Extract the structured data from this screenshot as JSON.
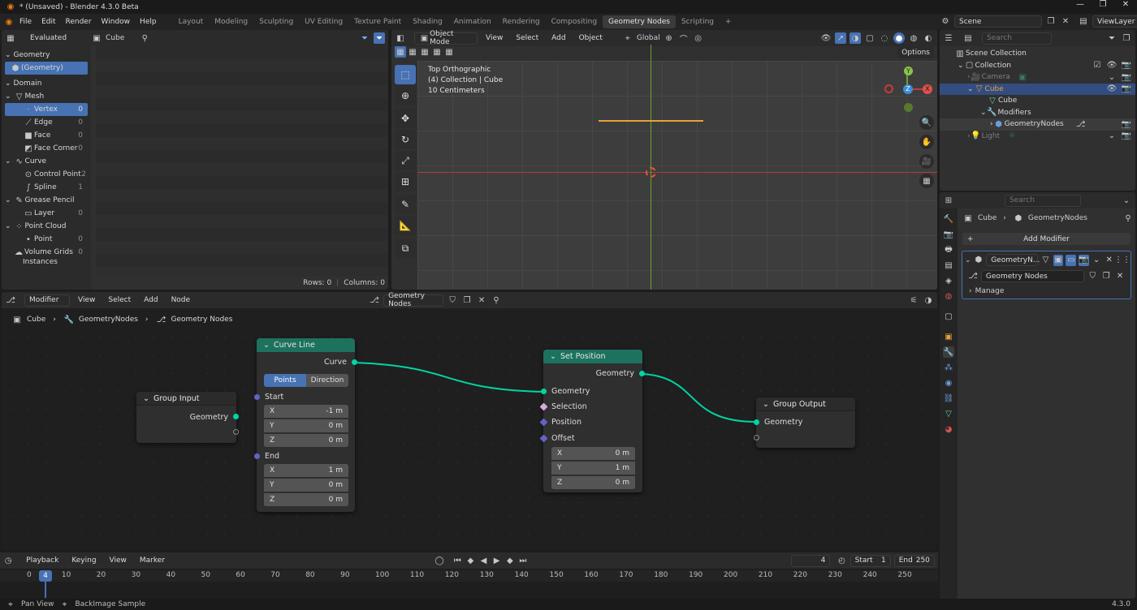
{
  "window": {
    "title": "* (Unsaved) - Blender 4.3.0 Beta"
  },
  "menu": [
    "File",
    "Edit",
    "Render",
    "Window",
    "Help"
  ],
  "workspaces": [
    "Layout",
    "Modeling",
    "Sculpting",
    "UV Editing",
    "Texture Paint",
    "Shading",
    "Animation",
    "Rendering",
    "Compositing",
    "Geometry Nodes",
    "Scripting"
  ],
  "active_workspace": "Geometry Nodes",
  "scene": {
    "name": "Scene",
    "view_layer": "ViewLayer"
  },
  "spreadsheet": {
    "mode": "Evaluated",
    "object": "Cube",
    "geometry_label": "Geometry",
    "geometry_item": "(Geometry)",
    "domain_label": "Domain",
    "mesh": {
      "label": "Mesh",
      "items": [
        {
          "label": "Vertex",
          "count": "0"
        },
        {
          "label": "Edge",
          "count": "0"
        },
        {
          "label": "Face",
          "count": "0"
        },
        {
          "label": "Face Corner",
          "count": "0"
        }
      ]
    },
    "curve": {
      "label": "Curve",
      "items": [
        {
          "label": "Control Point",
          "count": "2"
        },
        {
          "label": "Spline",
          "count": "1"
        }
      ]
    },
    "grease_pencil": {
      "label": "Grease Pencil",
      "items": [
        {
          "label": "Layer",
          "count": "0"
        }
      ]
    },
    "point_cloud": {
      "label": "Point Cloud",
      "items": [
        {
          "label": "Point",
          "count": "0"
        }
      ]
    },
    "volume": {
      "label": "Volume Grids",
      "count": "0"
    },
    "instances": "Instances",
    "rows": "Rows: 0",
    "columns": "Columns: 0"
  },
  "viewport": {
    "mode": "Object Mode",
    "menus": [
      "View",
      "Select",
      "Add",
      "Object"
    ],
    "transform": "Global",
    "options": "Options",
    "overlay": [
      "Top Orthographic",
      "(4) Collection | Cube",
      "10 Centimeters"
    ],
    "gizmo": {
      "y": "Y",
      "z": "Z",
      "x": "X"
    }
  },
  "node_editor": {
    "editor_type": "Modifier",
    "menus": [
      "View",
      "Select",
      "Add",
      "Node"
    ],
    "tree_name": "Geometry Nodes",
    "breadcrumb": [
      "Cube",
      "GeometryNodes",
      "Geometry Nodes"
    ],
    "group_input": {
      "title": "Group Input",
      "output": "Geometry"
    },
    "curve_line": {
      "title": "Curve Line",
      "output": "Curve",
      "mode_points": "Points",
      "mode_direction": "Direction",
      "start_label": "Start",
      "start": [
        {
          "axis": "X",
          "value": "-1 m"
        },
        {
          "axis": "Y",
          "value": "0 m"
        },
        {
          "axis": "Z",
          "value": "0 m"
        }
      ],
      "end_label": "End",
      "end": [
        {
          "axis": "X",
          "value": "1 m"
        },
        {
          "axis": "Y",
          "value": "0 m"
        },
        {
          "axis": "Z",
          "value": "0 m"
        }
      ]
    },
    "set_position": {
      "title": "Set Position",
      "output": "Geometry",
      "inputs": [
        "Geometry",
        "Selection",
        "Position",
        "Offset"
      ],
      "offset": [
        {
          "axis": "X",
          "value": "0 m"
        },
        {
          "axis": "Y",
          "value": "1 m"
        },
        {
          "axis": "Z",
          "value": "0 m"
        }
      ]
    },
    "group_output": {
      "title": "Group Output",
      "input": "Geometry"
    },
    "colors": {
      "geometry_socket": "#00d6a3",
      "vector_socket": "#6363c7",
      "curve_header": "#1d725e",
      "setpos_header": "#1d725e",
      "group_header": "#2b2b2b"
    }
  },
  "timeline": {
    "menus": [
      "Playback",
      "Keying",
      "View",
      "Marker"
    ],
    "current_frame": "4",
    "start_label": "Start",
    "start": "1",
    "end_label": "End",
    "end": "250",
    "ticks": [
      "0",
      "10",
      "20",
      "30",
      "40",
      "50",
      "60",
      "70",
      "80",
      "90",
      "100",
      "110",
      "120",
      "130",
      "140",
      "150",
      "160",
      "170",
      "180",
      "190",
      "200",
      "210",
      "220",
      "230",
      "240",
      "250"
    ]
  },
  "statusbar": {
    "left": [
      "Pan View",
      "BackImage Sample"
    ],
    "version": "4.3.0"
  },
  "outliner": {
    "search_placeholder": "Search",
    "rows": [
      {
        "label": "Scene Collection",
        "level": 0
      },
      {
        "label": "Collection",
        "level": 1
      },
      {
        "label": "Camera",
        "level": 2
      },
      {
        "label": "Cube",
        "level": 2,
        "selected": true
      },
      {
        "label": "Cube",
        "level": 3
      },
      {
        "label": "Modifiers",
        "level": 3
      },
      {
        "label": "GeometryNodes",
        "level": 4
      },
      {
        "label": "Light",
        "level": 2
      }
    ]
  },
  "properties": {
    "search_placeholder": "Search",
    "breadcrumb": [
      "Cube",
      "GeometryNodes"
    ],
    "add_modifier": "Add Modifier",
    "modifier_name": "GeometryN...",
    "tree": "Geometry Nodes",
    "manage": "Manage"
  }
}
